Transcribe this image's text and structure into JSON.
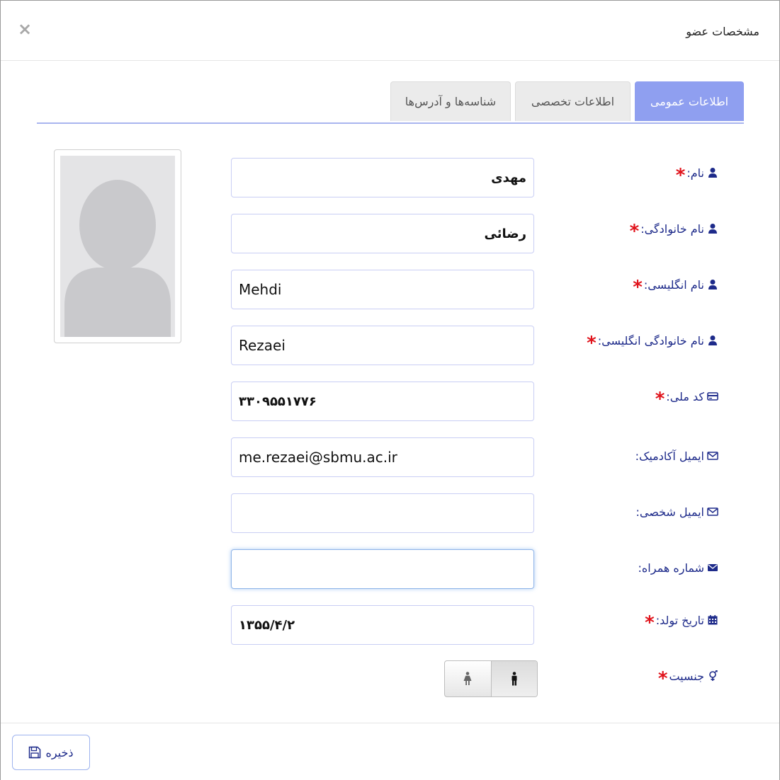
{
  "dialog": {
    "title": "مشخصات عضو",
    "close_glyph": "×"
  },
  "tabs": [
    {
      "label": "اطلاعات عمومی",
      "active": true
    },
    {
      "label": "اطلاعات تخصصی",
      "active": false
    },
    {
      "label": "شناسه‌ها و آدرس‌ها",
      "active": false
    }
  ],
  "form": {
    "first_name": {
      "label": "نام:",
      "value": "مهدی",
      "required": true,
      "icon": "user-icon"
    },
    "last_name": {
      "label": "نام خانوادگی:",
      "value": "رضائی",
      "required": true,
      "icon": "user-icon"
    },
    "english_first_name": {
      "label": "نام انگلیسی:",
      "value": "Mehdi",
      "required": true,
      "icon": "user-icon"
    },
    "english_last_name": {
      "label": "نام خانوادگی انگلیسی:",
      "value": "Rezaei",
      "required": true,
      "icon": "user-icon"
    },
    "national_code": {
      "label": "کد ملی:",
      "value": "۳۳۰۹۵۵۱۷۷۶",
      "required": true,
      "icon": "id-card-icon"
    },
    "academic_email": {
      "label": "ایمیل آکادمیک:",
      "value": "me.rezaei@sbmu.ac.ir",
      "required": false,
      "icon": "envelope-outline-icon"
    },
    "personal_email": {
      "label": "ایمیل شخصی:",
      "value": "",
      "required": false,
      "icon": "envelope-outline-icon"
    },
    "mobile": {
      "label": "شماره همراه:",
      "value": "",
      "required": false,
      "icon": "envelope-filled-icon"
    },
    "birth_date": {
      "label": "تاریخ تولد:",
      "value": "۱۳۵۵/۴/۲",
      "required": true,
      "icon": "calendar-icon"
    },
    "gender": {
      "label": "جنسیت",
      "required": true,
      "icon": "gender-icon",
      "selected": "male"
    }
  },
  "required_mark": "*",
  "footer": {
    "save_label": "ذخیره",
    "save_icon": "floppy-disk-icon"
  },
  "colors": {
    "accent": "#8f9ff0",
    "label": "#1d2a8a",
    "required": "#e0131b"
  }
}
